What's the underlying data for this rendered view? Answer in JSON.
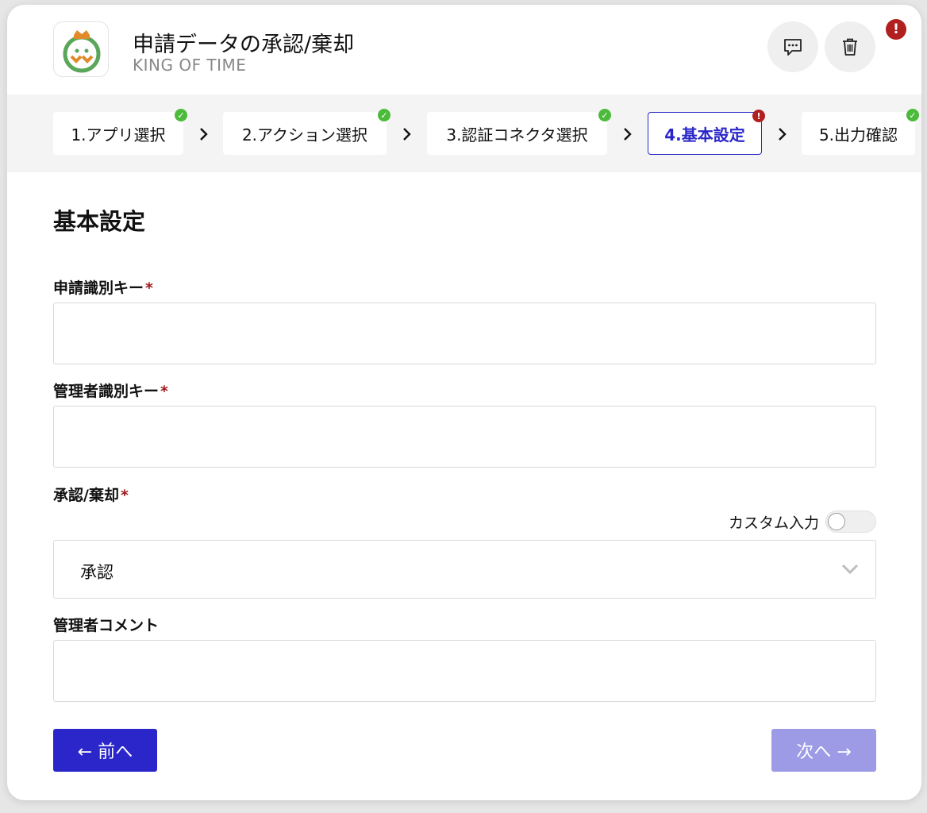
{
  "header": {
    "title": "申請データの承認/棄却",
    "subtitle": "KING OF TIME",
    "comment_icon": "comment-icon",
    "trash_icon": "trash-icon",
    "error_badge": "!"
  },
  "steps": [
    {
      "label": "1.アプリ選択",
      "status": "ok"
    },
    {
      "label": "2.アクション選択",
      "status": "ok"
    },
    {
      "label": "3.認証コネクタ選択",
      "status": "ok"
    },
    {
      "label": "4.基本設定",
      "status": "error",
      "active": true
    },
    {
      "label": "5.出力確認",
      "status": "ok"
    }
  ],
  "step_status_symbols": {
    "ok": "✓",
    "error": "!"
  },
  "section_title": "基本設定",
  "form": {
    "request_key": {
      "label": "申請識別キー",
      "required_mark": "*",
      "value": ""
    },
    "admin_key": {
      "label": "管理者識別キー",
      "required_mark": "*",
      "value": ""
    },
    "approve_reject": {
      "label": "承認/棄却",
      "required_mark": "*",
      "custom_input_label": "カスタム入力",
      "selected": "承認"
    },
    "admin_comment": {
      "label": "管理者コメント",
      "value": ""
    }
  },
  "buttons": {
    "prev": "← 前へ",
    "next": "次へ →"
  },
  "colors": {
    "primary": "#2a26c9",
    "primary_disabled": "#9d9be6",
    "ok": "#4cbb3b",
    "error": "#b21f1f",
    "required": "#a01818"
  }
}
